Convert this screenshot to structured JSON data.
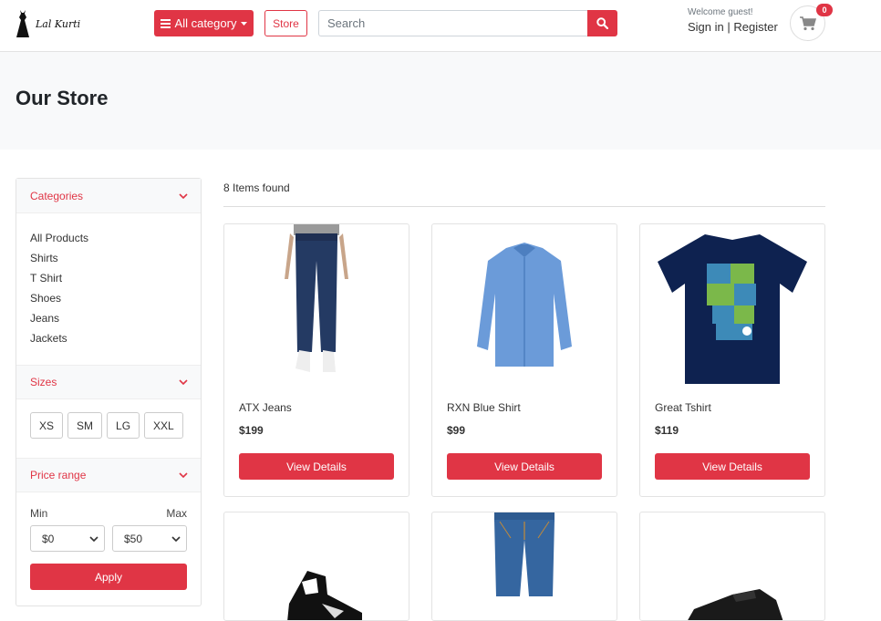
{
  "header": {
    "logo_text": "Lal Kurti",
    "category_button": "All category",
    "store_button": "Store",
    "search_placeholder": "Search",
    "welcome": "Welcome guest!",
    "sign_in": "Sign in",
    "separator": " | ",
    "register": "Register",
    "cart_count": "0"
  },
  "banner": {
    "title": "Our Store"
  },
  "sidebar": {
    "categories": {
      "title": "Categories",
      "items": [
        "All Products",
        "Shirts",
        "T Shirt",
        "Shoes",
        "Jeans",
        "Jackets"
      ]
    },
    "sizes": {
      "title": "Sizes",
      "items": [
        "XS",
        "SM",
        "LG",
        "XXL"
      ]
    },
    "price": {
      "title": "Price range",
      "min_label": "Min",
      "max_label": "Max",
      "min_value": "$0",
      "max_value": "$50",
      "apply": "Apply"
    }
  },
  "main": {
    "items_found": "8 Items found",
    "products": [
      {
        "name": "ATX Jeans",
        "price": "$199",
        "button": "View Details",
        "image": "jeans"
      },
      {
        "name": "RXN Blue Shirt",
        "price": "$99",
        "button": "View Details",
        "image": "shirt"
      },
      {
        "name": "Great Tshirt",
        "price": "$119",
        "button": "View Details",
        "image": "tshirt"
      },
      {
        "image": "sneaker"
      },
      {
        "image": "jeans-folded"
      },
      {
        "image": "black-shoe"
      }
    ]
  },
  "colors": {
    "accent": "#e03545",
    "banner": "#f8f9fa"
  }
}
